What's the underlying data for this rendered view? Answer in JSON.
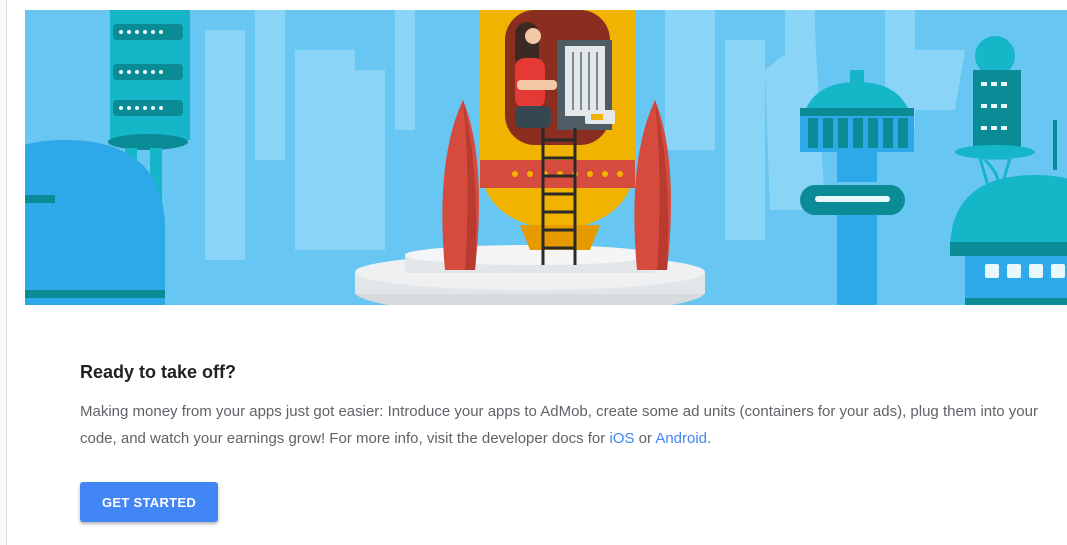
{
  "hero": {
    "colors": {
      "sky": "#67C6F2",
      "sky_shape": "#8AD4F7",
      "teal": "#16B6C9",
      "dark_teal": "#0A8B96",
      "rocket_yellow": "#F0B400",
      "rocket_red": "#D54B3D",
      "platform": "#E3E6E8"
    }
  },
  "promo": {
    "title": "Ready to take off?",
    "description_text": "Making money from your apps just got easier: Introduce your apps to AdMob, create some ad units (containers for your ads), plug them into your code, and watch your earnings grow! For more info, visit the developer docs for",
    "link_ios": "iOS",
    "connector": "or",
    "link_android": "Android",
    "suffix": ".",
    "button_label": "GET STARTED",
    "accent_color": "#4285F4"
  }
}
